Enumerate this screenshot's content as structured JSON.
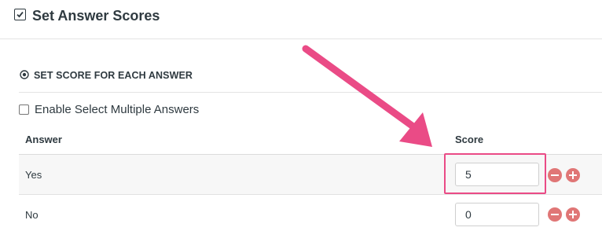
{
  "header": {
    "title": "Set Answer Scores"
  },
  "section": {
    "title": "SET SCORE FOR EACH ANSWER"
  },
  "options": {
    "multiple_label": "Enable Select Multiple Answers",
    "multiple_checked": false
  },
  "table": {
    "columns": {
      "answer": "Answer",
      "score": "Score"
    },
    "rows": [
      {
        "answer": "Yes",
        "score": "5"
      },
      {
        "answer": "No",
        "score": "0"
      }
    ]
  },
  "icons": {
    "header_checkbox": "checkbox-checked-icon",
    "section": "target-icon",
    "decrement": "minus-circle-icon",
    "increment": "plus-circle-icon"
  },
  "colors": {
    "text": "#2f3a40",
    "stepper": "#e07676",
    "annotation": "#ea4b86"
  }
}
